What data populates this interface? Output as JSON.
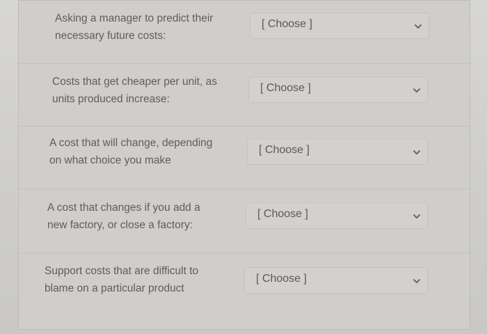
{
  "questions": [
    {
      "line1": "Asking a manager to predict their",
      "line2": "necessary future costs:",
      "select": {
        "value": "[ Choose ]",
        "icon": "chevron-down-icon"
      }
    },
    {
      "line1": "Costs that get cheaper per unit, as",
      "line2": "units produced increase:",
      "select": {
        "value": "[ Choose ]",
        "icon": "chevron-down-icon"
      }
    },
    {
      "line1": "A cost that will change, depending",
      "line2": "on what choice you make",
      "select": {
        "value": "[ Choose ]",
        "icon": "chevron-down-icon"
      }
    },
    {
      "line1": "A cost that changes if you add a",
      "line2": "new factory, or close a factory:",
      "select": {
        "value": "[ Choose ]",
        "icon": "chevron-down-icon"
      }
    },
    {
      "line1": "Support costs that are difficult to",
      "line2": "blame on a particular product",
      "select": {
        "value": "[ Choose ]",
        "icon": "chevron-down-icon"
      }
    }
  ]
}
